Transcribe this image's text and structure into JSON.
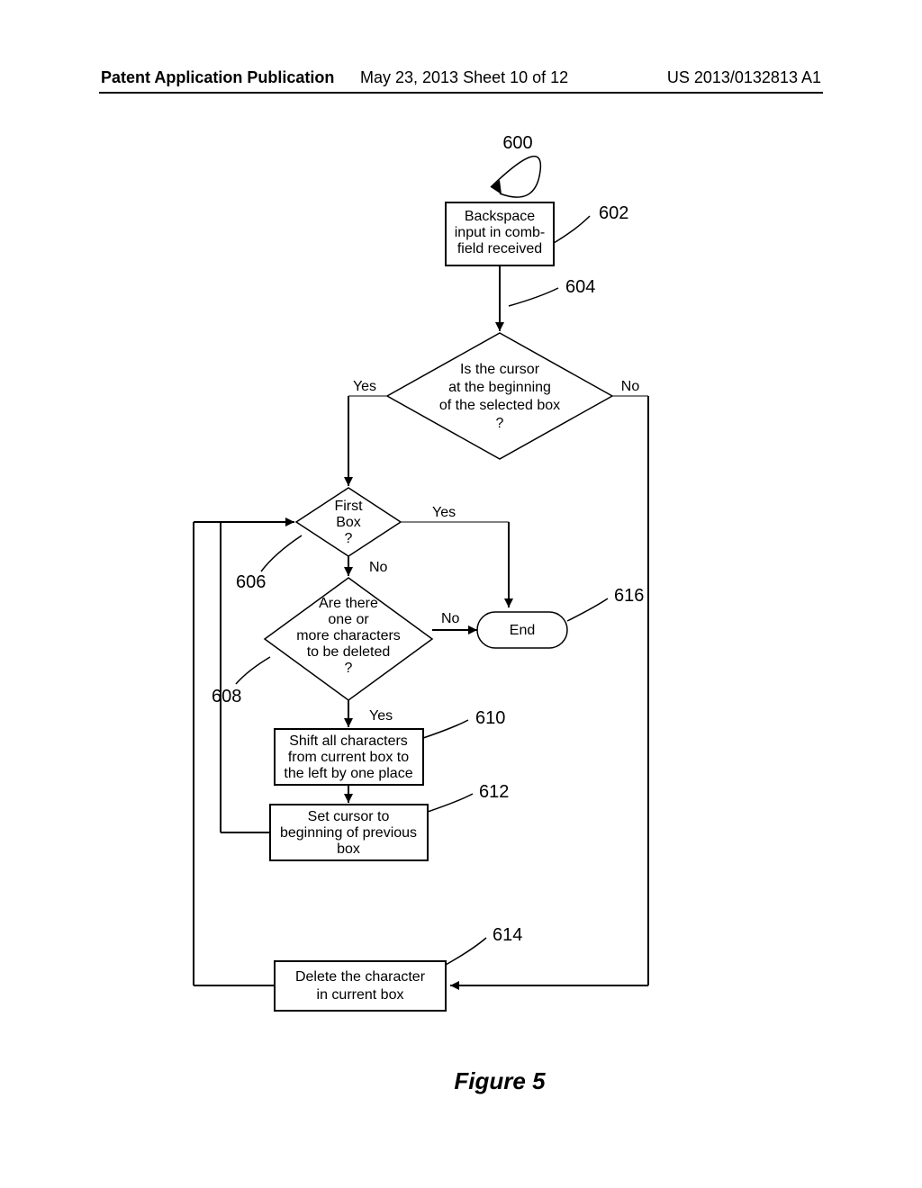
{
  "header": {
    "left": "Patent Application Publication",
    "center": "May 23, 2013  Sheet 10 of 12",
    "right": "US 2013/0132813 A1"
  },
  "labels": {
    "n600": "600",
    "n602": "602",
    "n604": "604",
    "n606": "606",
    "n608": "608",
    "n610": "610",
    "n612": "612",
    "n614": "614",
    "n616": "616",
    "yes": "Yes",
    "no": "No"
  },
  "nodes": {
    "box602_l1": "Backspace",
    "box602_l2": "input in comb-",
    "box602_l3": "field received",
    "dia604_l1": "Is the cursor",
    "dia604_l2": "at the beginning",
    "dia604_l3": "of the selected box",
    "dia604_l4": "?",
    "dia606_l1": "First",
    "dia606_l2": "Box",
    "dia606_l3": "?",
    "dia608_l1": "Are there",
    "dia608_l2": "one or",
    "dia608_l3": "more characters",
    "dia608_l4": "to be deleted",
    "dia608_l5": "?",
    "box610_l1": "Shift all characters",
    "box610_l2": "from current box to",
    "box610_l3": "the left by one place",
    "box612_l1": "Set cursor to",
    "box612_l2": "beginning of previous",
    "box612_l3": "box",
    "end": "End",
    "box614_l1": "Delete the character",
    "box614_l2": "in current box"
  },
  "caption": "Figure 5"
}
